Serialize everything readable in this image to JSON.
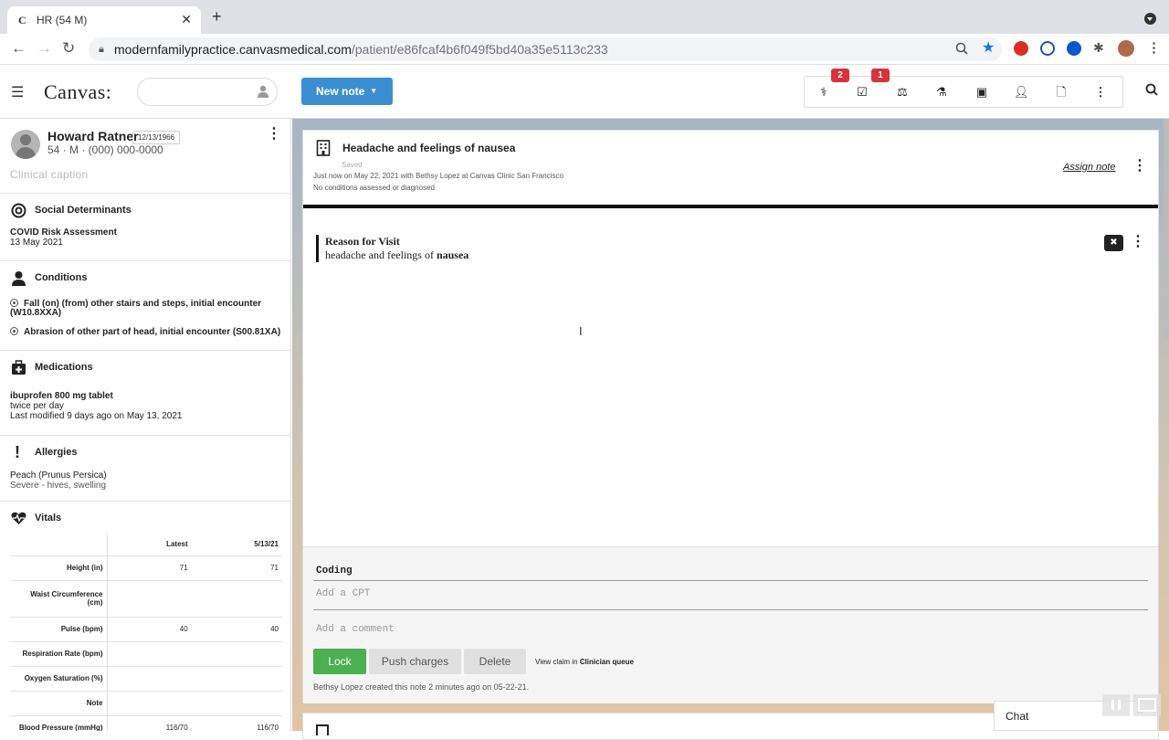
{
  "browser": {
    "tab_title": "HR (54 M)",
    "tab_favicon": "C",
    "url_host": "modernfamilypractice.canvasmedical.com",
    "url_path": "/patient/e86fcaf4b6f049f5bd40a35e5113c233"
  },
  "app": {
    "logo": "Canvas:",
    "new_note_label": "New note",
    "badges": {
      "protocols": "2",
      "tasks": "1"
    }
  },
  "patient": {
    "name": "Howard Ratner",
    "dob": "12/13/1966",
    "info": "54 · M · (000) 000-0000",
    "caption": "Clinical caption"
  },
  "sections": {
    "social": {
      "title": "Social Determinants",
      "item": "COVID Risk Assessment",
      "date": "13 May 2021"
    },
    "conditions": {
      "title": "Conditions",
      "items": [
        "Fall (on) (from) other stairs and steps, initial encounter",
        "(W10.8XXA)",
        "Abrasion of other part of head, initial encounter (S00.81XA)"
      ]
    },
    "medications": {
      "title": "Medications",
      "name": "ibuprofen 800 mg tablet",
      "freq": "twice per day",
      "modified": "Last modified 9 days ago on May 13, 2021"
    },
    "allergies": {
      "title": "Allergies",
      "name": "Peach (Prunus Persica)",
      "detail": "Severe - hives, swelling"
    },
    "vitals": {
      "title": "Vitals",
      "headers": [
        "Latest",
        "5/13/21"
      ],
      "rows": [
        {
          "label": "Height (in)",
          "latest": "71",
          "prev": "71"
        },
        {
          "label": "Waist Circumference (cm)",
          "latest": "",
          "prev": ""
        },
        {
          "label": "Pulse (bpm)",
          "latest": "40",
          "prev": "40"
        },
        {
          "label": "Respiration Rate (bpm)",
          "latest": "",
          "prev": ""
        },
        {
          "label": "Oxygen Saturation (%)",
          "latest": "",
          "prev": ""
        },
        {
          "label": "Note",
          "latest": "",
          "prev": ""
        },
        {
          "label": "Blood Pressure (mmHg)",
          "latest": "116/70",
          "prev": "116/70"
        }
      ]
    }
  },
  "note": {
    "title": "Headache and feelings of nausea",
    "saved": "Saved",
    "meta1": "Just now on May 22, 2021 with Bethsy Lopez at Canvas Clinic San Francisco",
    "meta2": "No conditions assessed or diagnosed",
    "assign": "Assign note",
    "rfv_heading": "Reason for Visit",
    "rfv_text": "headache and feelings of",
    "rfv_bold": "nausea",
    "coding_heading": "Coding",
    "cpt_placeholder": "Add a CPT",
    "comment_placeholder": "Add a comment",
    "lock": "Lock",
    "push": "Push charges",
    "delete": "Delete",
    "view_claim_prefix": "View claim in",
    "view_claim_link": "Clinician queue",
    "created": "Bethsy Lopez created this note 2 minutes ago on 05-22-21."
  },
  "chat": {
    "label": "Chat"
  }
}
